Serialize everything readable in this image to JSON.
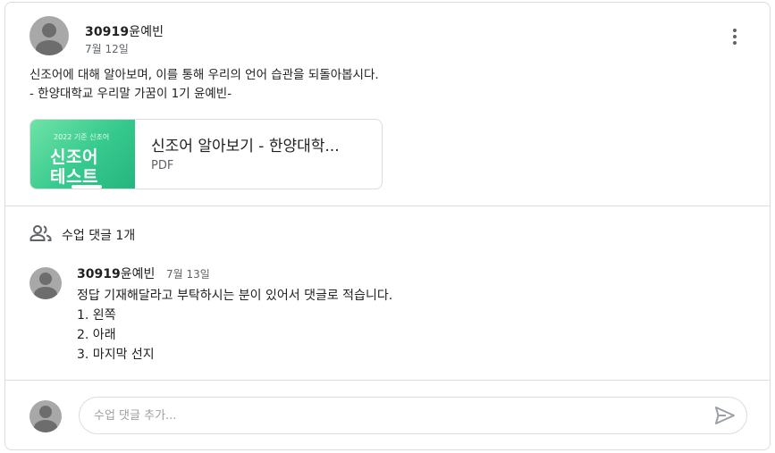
{
  "post": {
    "author_id": "30919",
    "author_name": "윤예빈",
    "date": "7월 12일",
    "body_line1": "신조어에 대해 알아보며, 이를 통해 우리의 언어 습관을 되돌아봅시다.",
    "body_line2": "- 한양대학교 우리말 가꿈이 1기 윤예빈-",
    "more_icon": "more-vert-icon"
  },
  "attachment": {
    "thumb_small_text": "2022 기준 신조어",
    "thumb_big_line1": "신조어",
    "thumb_big_line2": "테스트",
    "title": "신조어 알아보기 - 한양대학...",
    "type": "PDF"
  },
  "comments_header": {
    "icon": "people-icon",
    "label": "수업 댓글 1개"
  },
  "comments": [
    {
      "author_id": "30919",
      "author_name": "윤예빈",
      "date": "7월 13일",
      "lines": [
        "정답 기재해달라고 부탁하시는 분이 있어서 댓글로 적습니다.",
        "1. 왼쪽",
        "2. 아래",
        "3. 마지막 선지"
      ]
    }
  ],
  "add_comment": {
    "placeholder": "수업 댓글 추가...",
    "send_icon": "send-icon"
  },
  "colors": {
    "border": "#dadce0",
    "secondary_text": "#5f6368",
    "thumb_green": "#36c98d"
  }
}
